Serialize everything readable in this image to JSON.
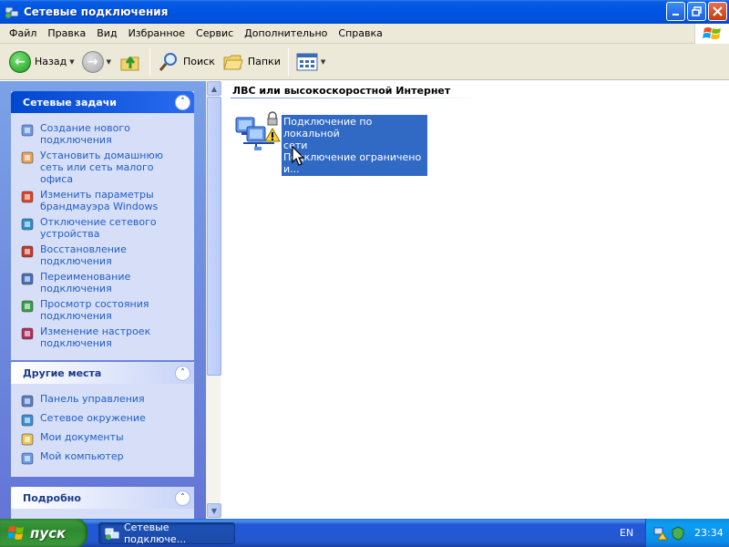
{
  "window": {
    "title": "Сетевые подключения",
    "controls": [
      "minimize",
      "maximize",
      "close"
    ]
  },
  "menu": [
    "Файл",
    "Правка",
    "Вид",
    "Избранное",
    "Сервис",
    "Дополнительно",
    "Справка"
  ],
  "toolbar": {
    "back_label": "Назад",
    "search_label": "Поиск",
    "folders_label": "Папки"
  },
  "sidebar": {
    "network_tasks": {
      "title": "Сетевые задачи",
      "items": [
        {
          "label": "Создание нового подключения",
          "icon": "new-connection-icon"
        },
        {
          "label": "Установить домашнюю сеть или сеть малого офиса",
          "icon": "home-network-icon"
        },
        {
          "label": "Изменить параметры брандмауэра Windows",
          "icon": "firewall-icon"
        },
        {
          "label": "Отключение сетевого устройства",
          "icon": "disable-device-icon"
        },
        {
          "label": "Восстановление подключения",
          "icon": "repair-icon"
        },
        {
          "label": "Переименование подключения",
          "icon": "rename-icon"
        },
        {
          "label": "Просмотр состояния подключения",
          "icon": "status-icon"
        },
        {
          "label": "Изменение настроек подключения",
          "icon": "settings-icon"
        }
      ]
    },
    "other_places": {
      "title": "Другие места",
      "items": [
        {
          "label": "Панель управления",
          "icon": "control-panel-icon"
        },
        {
          "label": "Сетевое окружение",
          "icon": "network-places-icon"
        },
        {
          "label": "Мои документы",
          "icon": "my-documents-icon"
        },
        {
          "label": "Мой компьютер",
          "icon": "my-computer-icon"
        }
      ]
    },
    "details": {
      "title": "Подробно"
    }
  },
  "main": {
    "group_title": "ЛВС или высокоскоростной Интернет",
    "connection": {
      "name_line1": "Подключение по локальной",
      "name_line2": "сети",
      "status": "Подключение ограничено и..."
    }
  },
  "taskbar": {
    "start_label": "пуск",
    "window_button": "Сетевые подключе...",
    "language": "EN",
    "clock": "23:34"
  },
  "colors": {
    "title_bar": "#0055e5",
    "selection": "#316ac5",
    "link": "#215dc6",
    "start_button": "#3c9a3c"
  }
}
